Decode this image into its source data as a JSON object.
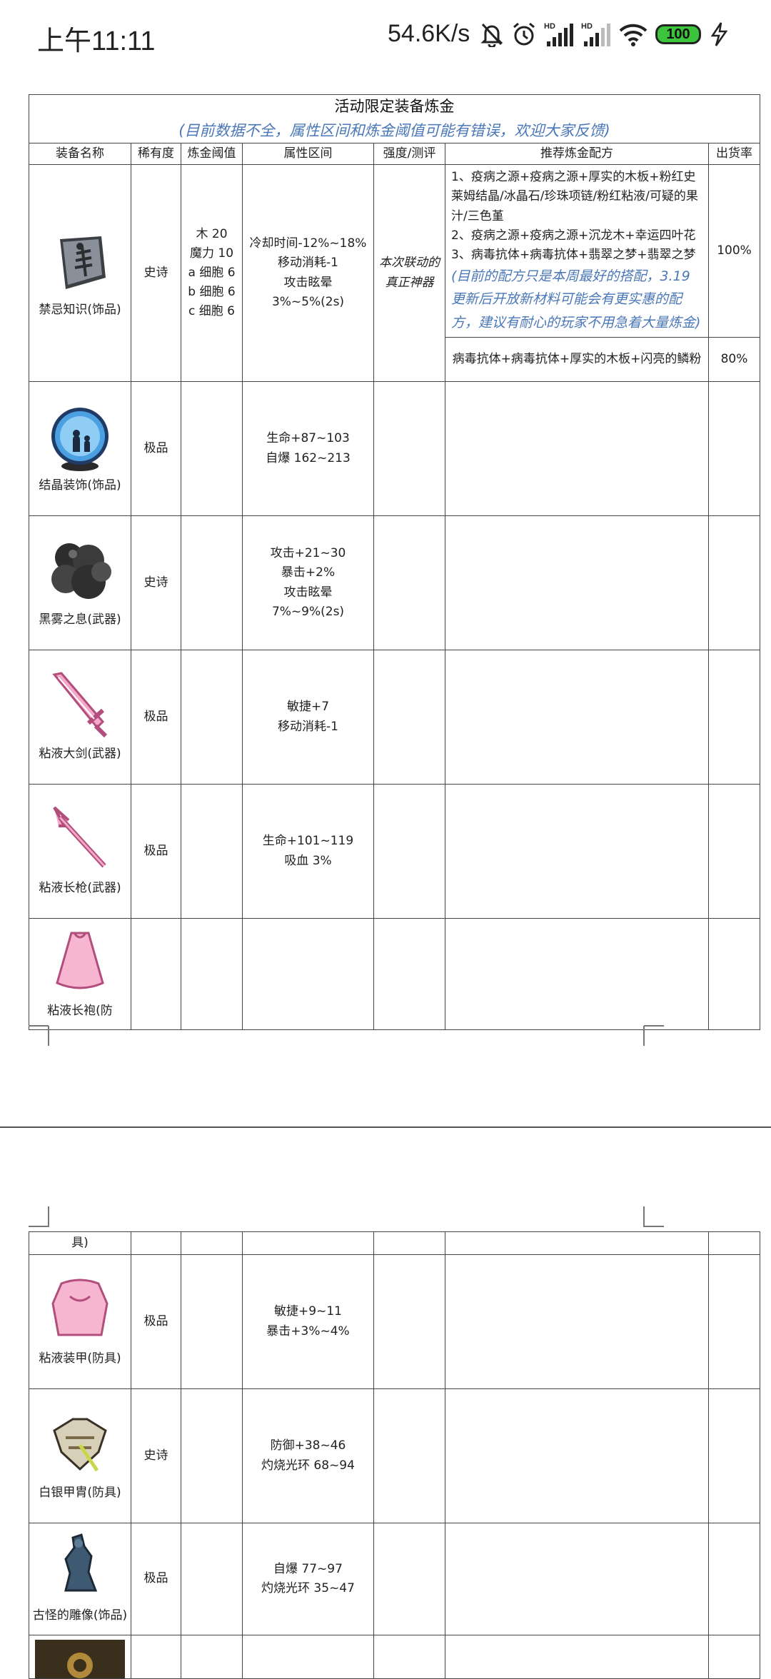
{
  "status_bar": {
    "time": "上午11:11",
    "network_speed": "54.6K/s",
    "battery": "100",
    "icons": [
      "mute-bell-icon",
      "alarm-icon",
      "hd-signal-icon",
      "hd-signal-icon",
      "wifi-icon",
      "battery-icon",
      "charging-icon"
    ]
  },
  "document": {
    "title": "活动限定装备炼金",
    "subtitle": "(目前数据不全，属性区间和炼金阈值可能有错误，欢迎大家反馈)",
    "headers": [
      "装备名称",
      "稀有度",
      "炼金阈值",
      "属性区间",
      "强度/测评",
      "推荐炼金配方",
      "出货率"
    ],
    "rows": [
      {
        "name": "禁忌知识(饰品)",
        "icon": "forbidden-knowledge-icon",
        "rarity": "史诗",
        "threshold": [
          "木 20",
          "魔力 10",
          "a 细胞 6",
          "b 细胞 6",
          "c 细胞 6"
        ],
        "attributes": [
          "冷却时间-12%~18%",
          "移动消耗-1",
          "攻击眩晕",
          "3%~5%(2s)"
        ],
        "evaluation": [
          "本次联动的",
          "真正神器"
        ],
        "recipes": [
          "1、疫病之源+疫病之源+厚实的木板+粉红史莱姆结晶/冰晶石/珍珠项链/粉红粘液/可疑的果汁/三色堇",
          "2、疫病之源+疫病之源+沉龙木+幸运四叶花",
          "3、病毒抗体+病毒抗体+翡翠之梦+翡翠之梦"
        ],
        "recipe_note": "(目前的配方只是本周最好的搭配，3.19 更新后开放新材料可能会有更实惠的配方，建议有耐心的玩家不用急着大量炼金)",
        "rate": "100%",
        "recipe2": "病毒抗体+病毒抗体+厚实的木板+闪亮的鳞粉",
        "rate2": "80%"
      },
      {
        "name": "结晶装饰(饰品)",
        "icon": "crystal-ornament-icon",
        "rarity": "极品",
        "attributes": [
          "生命+87~103",
          "自爆 162~213"
        ]
      },
      {
        "name": "黑雾之息(武器)",
        "icon": "black-mist-icon",
        "rarity": "史诗",
        "attributes": [
          "攻击+21~30",
          "暴击+2%",
          "攻击眩晕",
          "7%~9%(2s)"
        ]
      },
      {
        "name": "粘液大剑(武器)",
        "icon": "slime-greatsword-icon",
        "rarity": "极品",
        "attributes": [
          "敏捷+7",
          "移动消耗-1"
        ]
      },
      {
        "name": "粘液长枪(武器)",
        "icon": "slime-spear-icon",
        "rarity": "极品",
        "attributes": [
          "生命+101~119",
          "吸血 3%"
        ]
      },
      {
        "name": "粘液长袍(防",
        "icon": "slime-robe-icon"
      }
    ],
    "page2_rows": [
      {
        "name": "具)"
      },
      {
        "name": "粘液装甲(防具)",
        "icon": "slime-armor-icon",
        "rarity": "极品",
        "attributes": [
          "敏捷+9~11",
          "暴击+3%~4%"
        ]
      },
      {
        "name": "白银甲胄(防具)",
        "icon": "silver-armor-icon",
        "rarity": "史诗",
        "attributes": [
          "防御+38~46",
          "灼烧光环 68~94"
        ]
      },
      {
        "name": "古怪的雕像(饰品)",
        "icon": "strange-statue-icon",
        "rarity": "极品",
        "attributes": [
          "自爆 77~97",
          "灼烧光环 35~47"
        ]
      },
      {
        "name": "",
        "icon": "next-item-icon"
      }
    ]
  }
}
